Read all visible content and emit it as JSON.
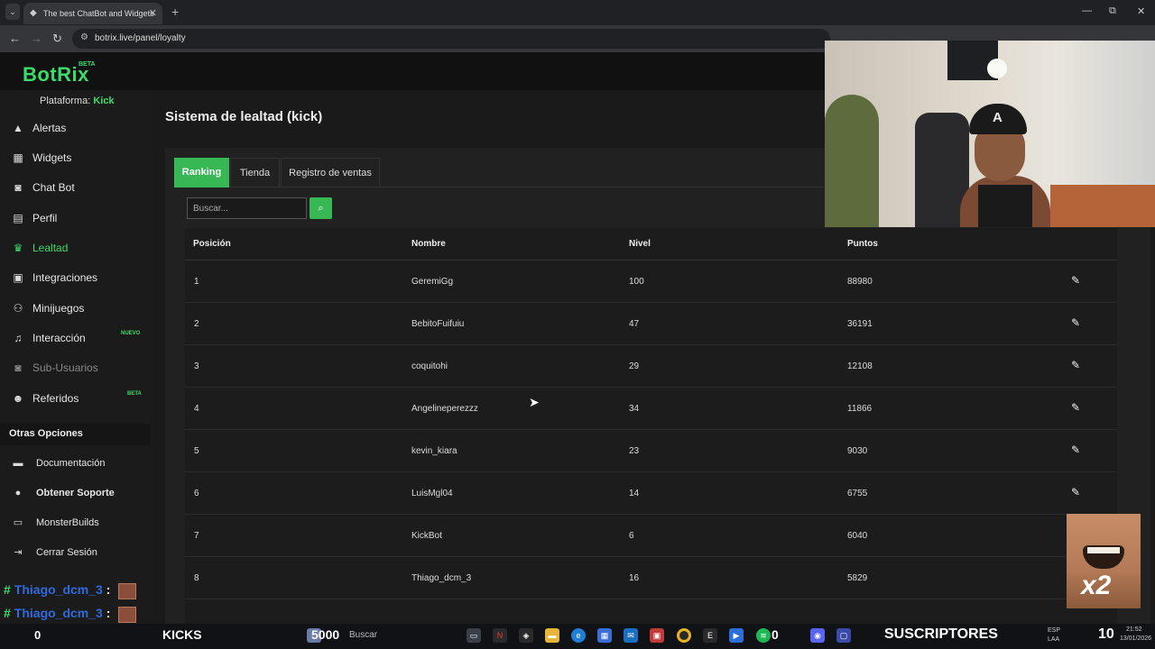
{
  "browser": {
    "tab_title": "The best ChatBot and Widgets",
    "url": "botrix.live/panel/loyalty",
    "new_tab": "+",
    "tab_menu": "⌄",
    "win_min": "—",
    "win_max": "⧉",
    "win_close": "✕"
  },
  "site": {
    "logo": "BotRix",
    "logo_beta": "BETA"
  },
  "sidebar": {
    "platform_label": "Plataforma:",
    "platform_value": "Kick",
    "items": [
      {
        "label": "Alertas",
        "icon": "warning-icon"
      },
      {
        "label": "Widgets",
        "icon": "grid-icon"
      },
      {
        "label": "Chat Bot",
        "icon": "robot-icon"
      },
      {
        "label": "Perfil",
        "icon": "id-card-icon"
      },
      {
        "label": "Lealtad",
        "icon": "trophy-icon"
      },
      {
        "label": "Integraciones",
        "icon": "integration-icon"
      },
      {
        "label": "Minijuegos",
        "icon": "gamepad-icon"
      },
      {
        "label": "Interacción",
        "icon": "music-icon"
      },
      {
        "label": "Sub-Usuarios",
        "icon": "robot-icon"
      },
      {
        "label": "Referidos",
        "icon": "users-icon"
      }
    ],
    "badge_nuevo": "NUEVO",
    "badge_beta": "BETA",
    "other_title": "Otras Opciones",
    "other_items": [
      {
        "label": "Documentación",
        "icon": "document-icon"
      },
      {
        "label": "Obtener Soporte",
        "icon": "question-icon"
      },
      {
        "label": "MonsterBuilds",
        "icon": "monitor-icon"
      },
      {
        "label": "Cerrar Sesión",
        "icon": "logout-icon"
      }
    ]
  },
  "chat_overlay": [
    {
      "user": "Thiago_dcm_3",
      "sep": ":"
    },
    {
      "user": "Thiago_dcm_3",
      "sep": ":"
    }
  ],
  "main": {
    "title": "Sistema de lealtad (kick)",
    "tabs": [
      "Ranking",
      "Tienda",
      "Registro de ventas"
    ],
    "search_placeholder": "Buscar...",
    "columns": [
      "Posición",
      "Nombre",
      "Nivel",
      "Puntos"
    ],
    "rows": [
      {
        "pos": "1",
        "name": "GeremiGg",
        "level": "100",
        "points": "88980"
      },
      {
        "pos": "2",
        "name": "BebitoFuifuiu",
        "level": "47",
        "points": "36191"
      },
      {
        "pos": "3",
        "name": "coquitohi",
        "level": "29",
        "points": "12108"
      },
      {
        "pos": "4",
        "name": "Angelineperezzz",
        "level": "34",
        "points": "11866"
      },
      {
        "pos": "5",
        "name": "kevin_kiara",
        "level": "23",
        "points": "9030"
      },
      {
        "pos": "6",
        "name": "LuisMgl04",
        "level": "14",
        "points": "6755"
      },
      {
        "pos": "7",
        "name": "KickBot",
        "level": "6",
        "points": "6040"
      },
      {
        "pos": "8",
        "name": "Thiago_dcm_3",
        "level": "16",
        "points": "5829"
      }
    ]
  },
  "overlay": {
    "meme_text": "x2"
  },
  "taskbar": {
    "left_count": "0",
    "kicks_label": "KICKS",
    "points_value": "5000",
    "search_label": "Buscar",
    "subs_label": "SUSCRIPTORES",
    "subs_count": "10",
    "lang": "ESP",
    "lang2": "LAA",
    "time": "21:52",
    "date": "13/01/2026"
  },
  "colors": {
    "accent": "#3ddc6a",
    "button_green": "#38b755",
    "chat_blue": "#2f6bdc"
  }
}
